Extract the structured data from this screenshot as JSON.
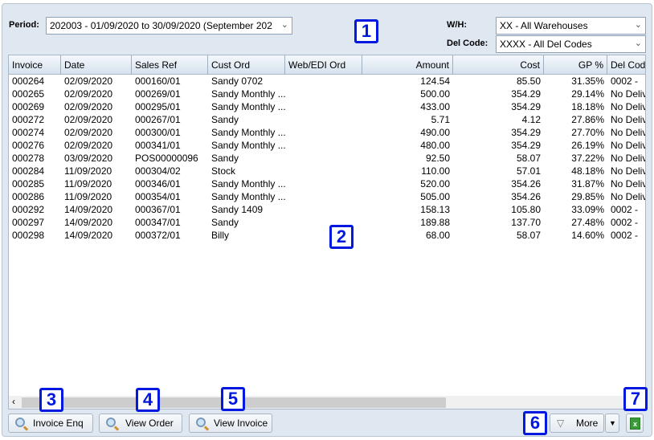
{
  "filters": {
    "period_label": "Period:",
    "period_value": "202003 - 01/09/2020 to 30/09/2020 (September 202",
    "wh_label": "W/H:",
    "wh_value": "XX - All Warehouses",
    "del_label": "Del Code:",
    "del_value": "XXXX - All Del Codes"
  },
  "callouts": [
    "1",
    "2",
    "3",
    "4",
    "5",
    "6",
    "7"
  ],
  "columns": [
    "Invoice",
    "Date",
    "Sales Ref",
    "Cust Ord",
    "Web/EDI Ord",
    "Amount",
    "Cost",
    "GP %",
    "Del Cod"
  ],
  "rows": [
    [
      "000264",
      "02/09/2020",
      "000160/01",
      "Sandy 0702",
      "",
      "124.54",
      "85.50",
      "31.35%",
      "0002 -"
    ],
    [
      "000265",
      "02/09/2020",
      "000269/01",
      "Sandy Monthly ...",
      "",
      "500.00",
      "354.29",
      "29.14%",
      "No Deliv"
    ],
    [
      "000269",
      "02/09/2020",
      "000295/01",
      "Sandy Monthly ...",
      "",
      "433.00",
      "354.29",
      "18.18%",
      "No Deliv"
    ],
    [
      "000272",
      "02/09/2020",
      "000267/01",
      "Sandy",
      "",
      "5.71",
      "4.12",
      "27.86%",
      "No Deliv"
    ],
    [
      "000274",
      "02/09/2020",
      "000300/01",
      "Sandy Monthly ...",
      "",
      "490.00",
      "354.29",
      "27.70%",
      "No Deliv"
    ],
    [
      "000276",
      "02/09/2020",
      "000341/01",
      "Sandy Monthly ...",
      "",
      "480.00",
      "354.29",
      "26.19%",
      "No Deliv"
    ],
    [
      "000278",
      "03/09/2020",
      "POS00000096",
      "Sandy",
      "",
      "92.50",
      "58.07",
      "37.22%",
      "No Deliv"
    ],
    [
      "000284",
      "11/09/2020",
      "000304/02",
      "Stock",
      "",
      "110.00",
      "57.01",
      "48.18%",
      "No Deliv"
    ],
    [
      "000285",
      "11/09/2020",
      "000346/01",
      "Sandy Monthly ...",
      "",
      "520.00",
      "354.26",
      "31.87%",
      "No Deliv"
    ],
    [
      "000286",
      "11/09/2020",
      "000354/01",
      "Sandy Monthly ...",
      "",
      "505.00",
      "354.26",
      "29.85%",
      "No Deliv"
    ],
    [
      "000292",
      "14/09/2020",
      "000367/01",
      "Sandy 1409",
      "",
      "158.13",
      "105.80",
      "33.09%",
      "0002 -"
    ],
    [
      "000297",
      "14/09/2020",
      "000347/01",
      "Sandy",
      "",
      "189.88",
      "137.70",
      "27.48%",
      "0002 -"
    ],
    [
      "000298",
      "14/09/2020",
      "000372/01",
      "Billy",
      "",
      "68.00",
      "58.07",
      "14.60%",
      "0002 -"
    ]
  ],
  "buttons": {
    "invoice_enq": "Invoice Enq",
    "view_order": "View Order",
    "view_invoice": "View Invoice",
    "more": "More"
  },
  "colors": {
    "callout": "#0018e0",
    "panel": "#dfe7f1"
  }
}
